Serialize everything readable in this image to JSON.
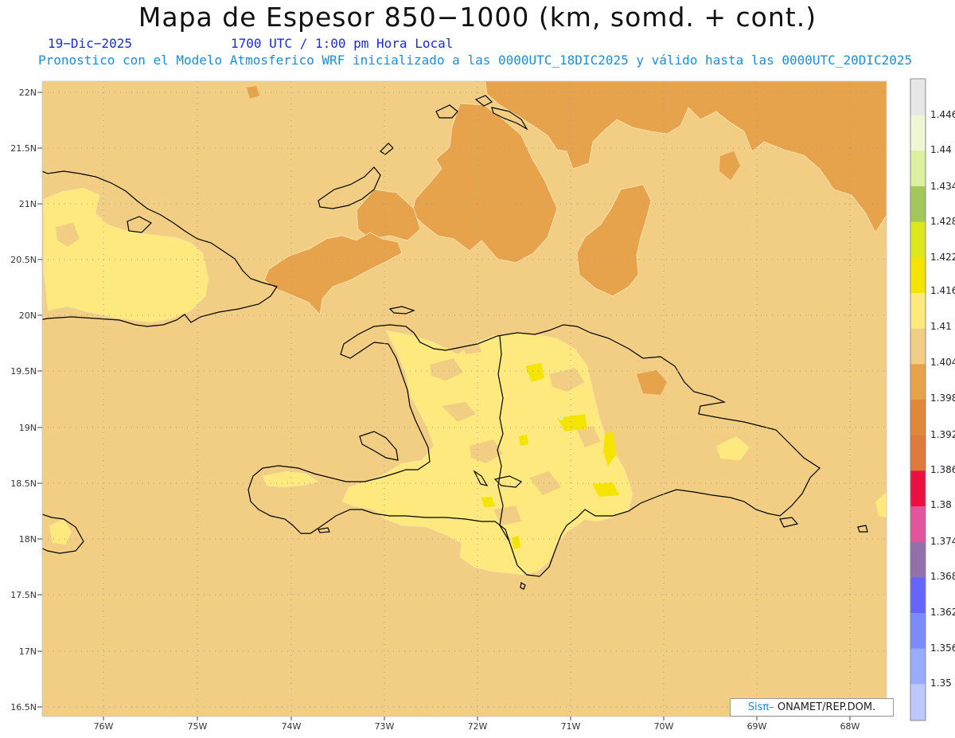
{
  "header": {
    "title": "Mapa de Espesor 850−1000 (km, somd. + cont.)",
    "date": "19−Dic−2025",
    "time": "1700 UTC / 1:00 pm Hora Local",
    "model": "Pronostico con el Modelo Atmosferico WRF inicializado a las 0000UTC_18DIC2025 y válido hasta las  0000UTC_20DIC2025"
  },
  "map": {
    "lat_labels": [
      "22N",
      "21.5N",
      "21N",
      "20.5N",
      "20N",
      "19.5N",
      "19N",
      "18.5N",
      "18N",
      "17.5N",
      "17N",
      "16.5N"
    ],
    "lon_labels": [
      "76W",
      "75W",
      "74W",
      "73W",
      "72W",
      "71W",
      "70W",
      "69W",
      "68W"
    ],
    "background_fill": "#f1ce84",
    "colors": {
      "1.398": "#e7a24c",
      "1.404": "#f1ce84",
      "1.41": "#fde97d",
      "1.416": "#f5e400"
    }
  },
  "colorbar": {
    "levels": [
      "1.446",
      "1.44",
      "1.434",
      "1.428",
      "1.422",
      "1.416",
      "1.41",
      "1.404",
      "1.398",
      "1.392",
      "1.386",
      "1.38",
      "1.374",
      "1.368",
      "1.362",
      "1.356",
      "1.35"
    ],
    "colors": [
      "#e6e6e6",
      "#eef6d6",
      "#dcf0a0",
      "#a2c85a",
      "#dbe81c",
      "#f5e400",
      "#fde97d",
      "#f1ce84",
      "#e7a24c",
      "#e08838",
      "#de7a3a",
      "#ea1040",
      "#e2559c",
      "#9270ac",
      "#6464ff",
      "#7c8cff",
      "#98acff",
      "#bcc8ff"
    ]
  },
  "credit": {
    "logo": "Sisπ–",
    "text": " ONAMET/REP.DOM."
  }
}
